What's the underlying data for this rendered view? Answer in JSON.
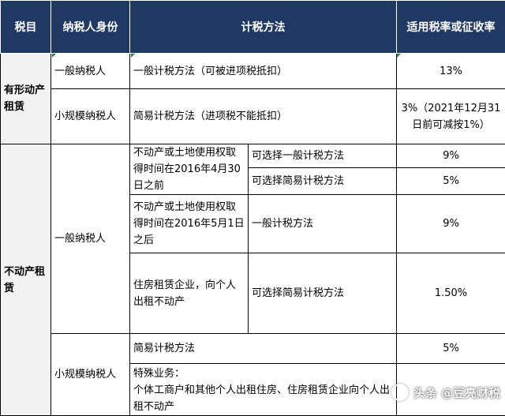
{
  "headers": {
    "tax_item": "税目",
    "taxpayer": "纳税人身份",
    "method": "计税方法",
    "rate": "适用税率或征收率"
  },
  "tangible": {
    "item": "有形动产租赁",
    "general_taxpayer": "一般纳税人",
    "general_method": "一般计税方法（可被进项税抵扣）",
    "general_rate": "13%",
    "small_taxpayer": "小规模纳税人",
    "small_method": "简易计税方法（进项税不能抵扣）",
    "small_rate": "3%（2021年12月31日前可减按1%）"
  },
  "realestate": {
    "item": "不动产租赁",
    "general_taxpayer": "一般纳税人",
    "before_condition": "不动产或土地使用权取得时间在2016年4月30日之前",
    "before_opt1": "可选择一般计税方法",
    "before_rate1": "9%",
    "before_opt2": "可选择简易计税方法",
    "before_rate2": "5%",
    "after_condition": "不动产或土地使用权取得时间在2016年5月1日之后",
    "after_method": "一般计税方法",
    "after_rate": "9%",
    "housing_condition": "住房租赁企业，向个人出租不动产",
    "housing_method": "可选择简易计税方法",
    "housing_rate": "1.50%",
    "small_taxpayer": "小规模纳税人",
    "small_method": "简易计税方法",
    "small_rate": "5%",
    "special_title": "特殊业务：",
    "special_desc": "个体工商户和其他个人出租住房、住房租赁企业向个人出租不动产"
  },
  "watermark": {
    "text": "头条 @豆亮财税",
    "icon": "circle-logo-icon"
  },
  "colors": {
    "header_bg": "#1f3864",
    "header_text": "#ffffff",
    "tax_item_bg": "#f2f2f2",
    "corner_mark": "#1e8a3a"
  }
}
